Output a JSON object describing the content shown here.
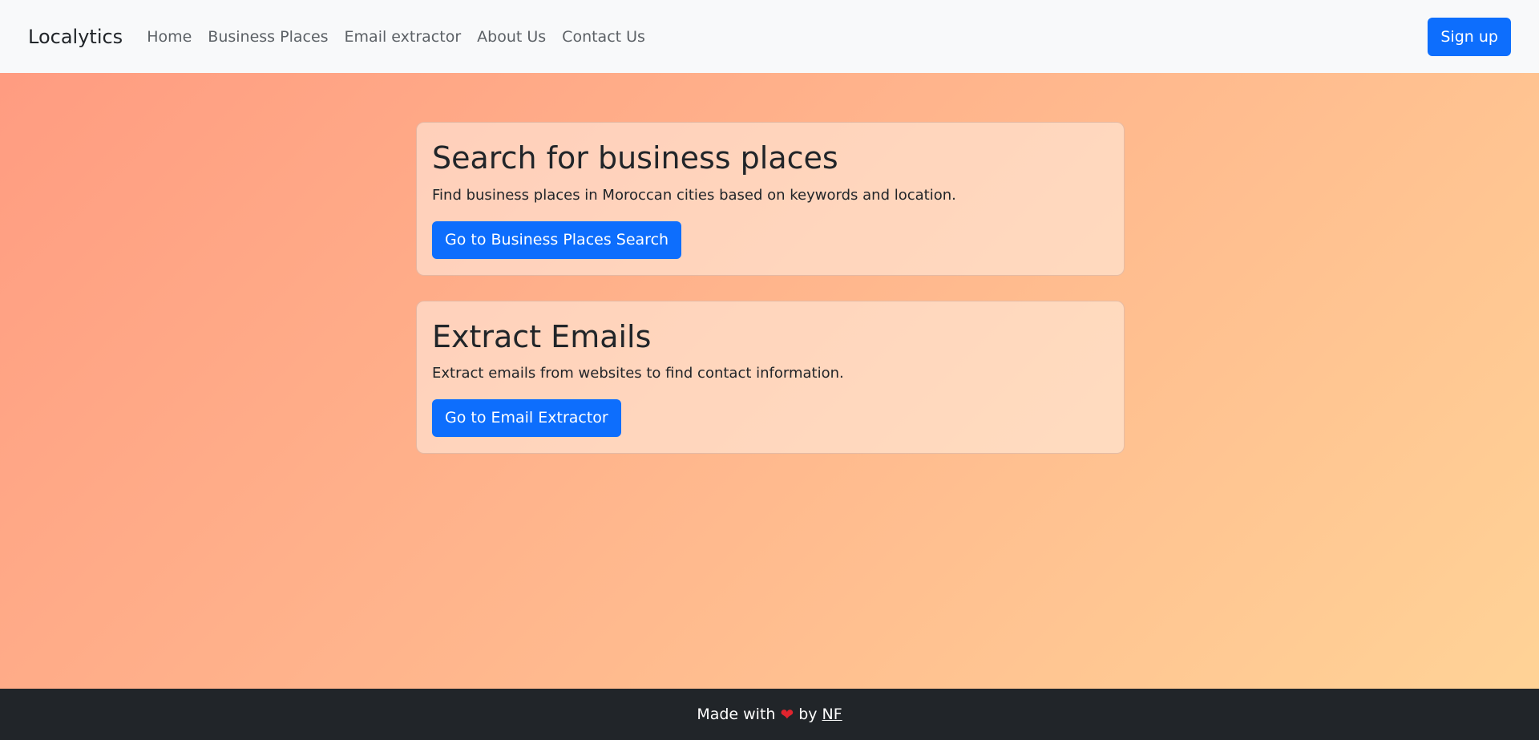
{
  "navbar": {
    "brand": "Localytics",
    "links": [
      "Home",
      "Business Places",
      "Email extractor",
      "About Us",
      "Contact Us"
    ],
    "signup_label": "Sign up"
  },
  "cards": [
    {
      "title": "Search for business places",
      "description": "Find business places in Moroccan cities based on keywords and location.",
      "button_label": "Go to Business Places Search"
    },
    {
      "title": "Extract Emails",
      "description": "Extract emails from websites to find contact information.",
      "button_label": "Go to Email Extractor"
    }
  ],
  "footer": {
    "made_with": "Made with",
    "heart_icon": "heart-icon",
    "by": "by",
    "author": "NF"
  },
  "colors": {
    "primary": "#0d6efd",
    "footer_bg": "#212529",
    "navbar_bg": "#f8f9fa",
    "heart": "#e0242e"
  }
}
